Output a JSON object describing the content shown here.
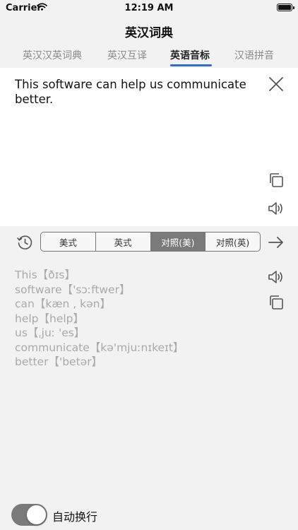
{
  "status_bar": {
    "carrier": "Carrier",
    "time": "12:19 AM"
  },
  "nav": {
    "title": "英汉词典"
  },
  "tabs": [
    {
      "label": "英汉汉英词典"
    },
    {
      "label": "英汉互译"
    },
    {
      "label": "英语音标",
      "active": true
    },
    {
      "label": "汉语拼音"
    }
  ],
  "input": {
    "text": "This software can help us communicate better."
  },
  "segment": {
    "options": [
      "美式",
      "英式",
      "对照(美)",
      "对照(英)"
    ],
    "selected": "对照(美)"
  },
  "result_lines": [
    "This【ðɪs】",
    "software【'sɔːftwer】",
    "can【kæn , kən】",
    "help【help】",
    "us【ˌjuː 'es】",
    "communicate【kə'mjuːnɪkeɪt】",
    "better【'betər】"
  ],
  "wrap_toggle": {
    "label": "自动换行",
    "on": true
  },
  "colors": {
    "accent": "#2a6fd6",
    "selected_segment": "#7a7a7a",
    "result_text": "#a9a9a9"
  },
  "icons": [
    "wifi-icon",
    "battery-icon",
    "close-icon",
    "copy-icon",
    "speaker-icon",
    "history-icon",
    "arrow-right-icon"
  ]
}
